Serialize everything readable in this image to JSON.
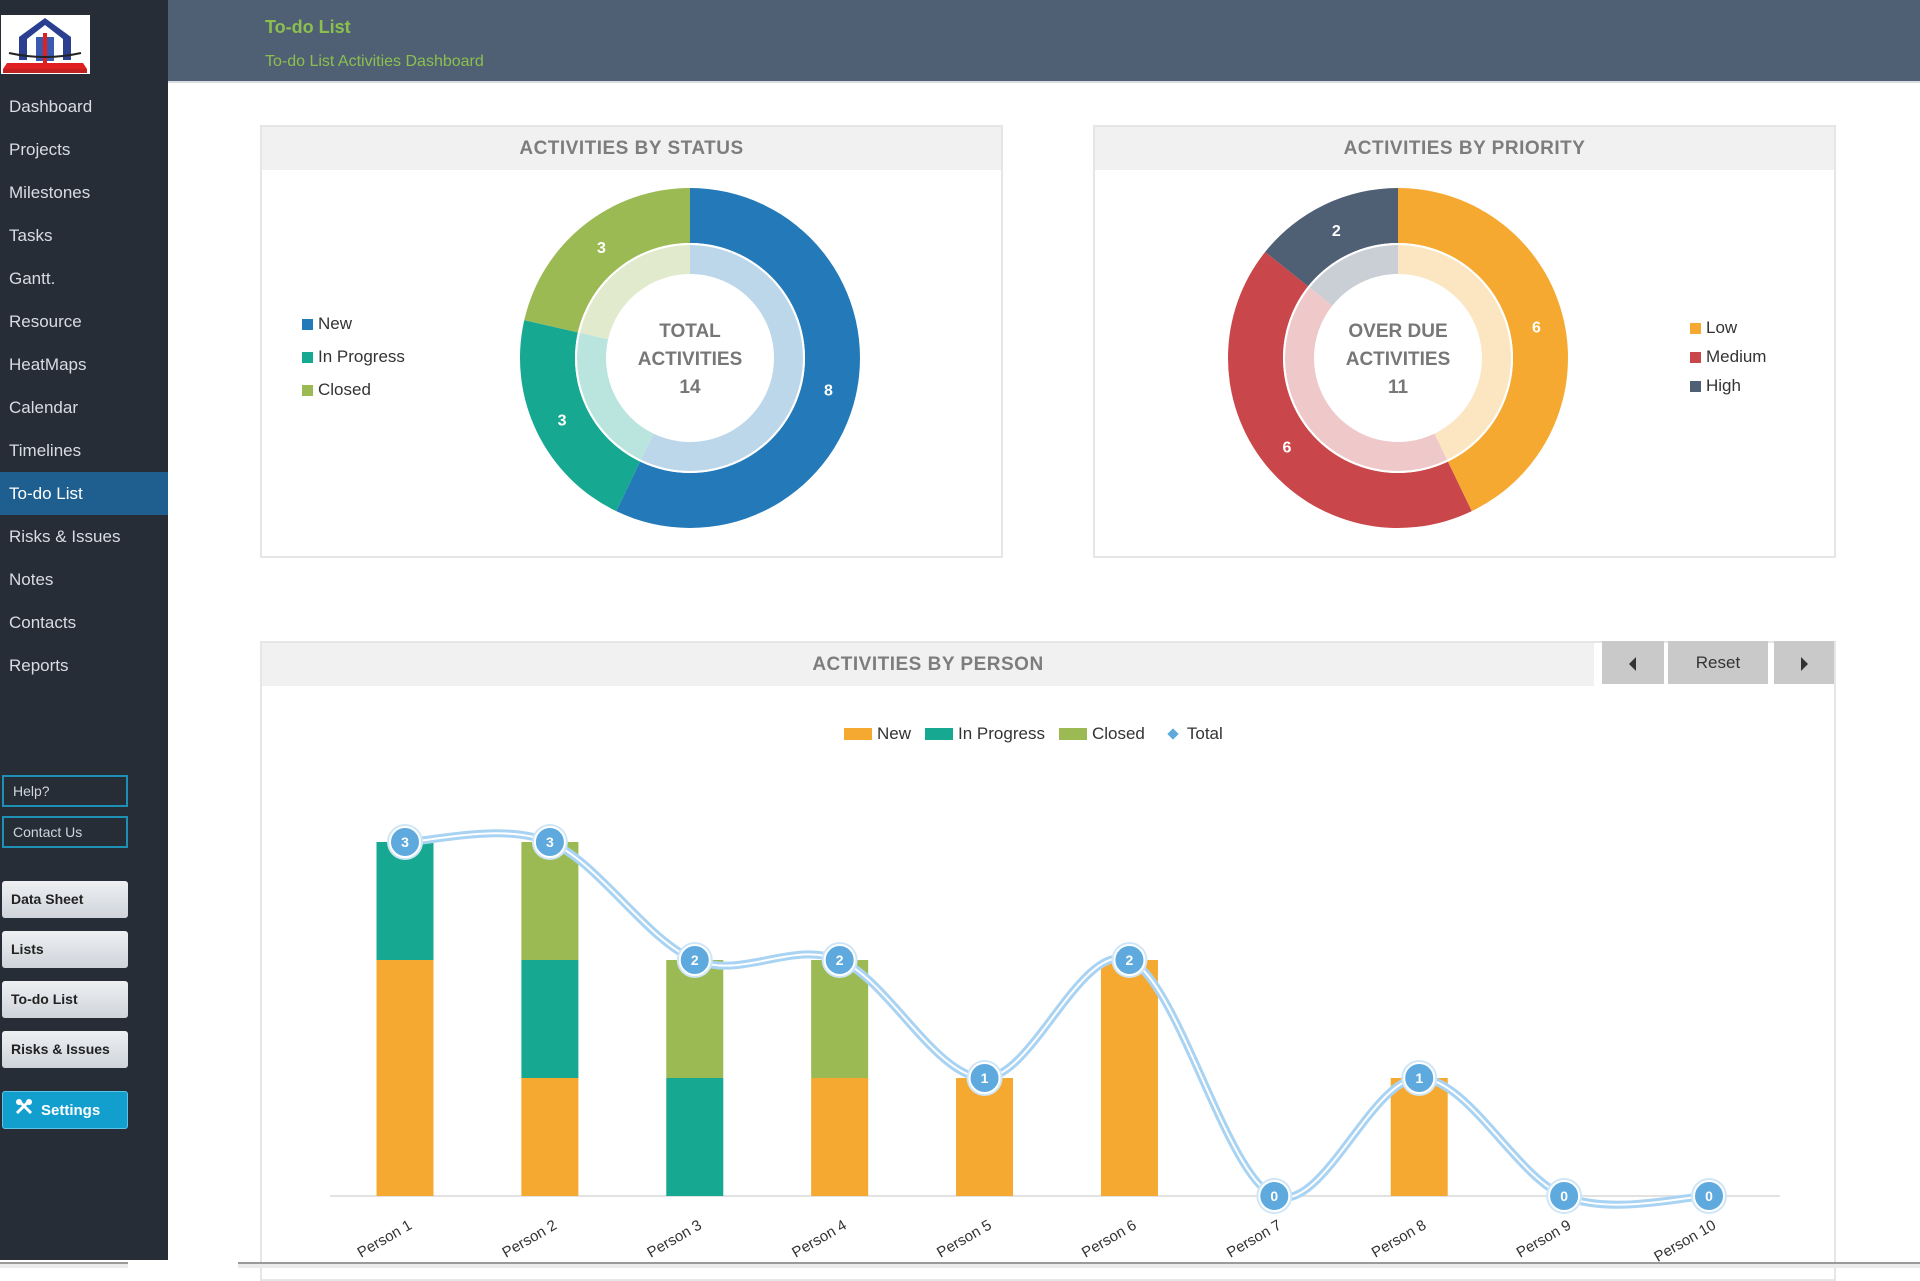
{
  "header": {
    "title": "To-do List",
    "subtitle": "To-do List Activities Dashboard"
  },
  "sidebar": {
    "logo": "company-logo",
    "items": [
      {
        "label": "Dashboard",
        "active": false
      },
      {
        "label": "Projects",
        "active": false
      },
      {
        "label": "Milestones",
        "active": false
      },
      {
        "label": "Tasks",
        "active": false
      },
      {
        "label": "Gantt.",
        "active": false
      },
      {
        "label": "Resource",
        "active": false
      },
      {
        "label": "HeatMaps",
        "active": false
      },
      {
        "label": "Calendar",
        "active": false
      },
      {
        "label": "Timelines",
        "active": false
      },
      {
        "label": "To-do List",
        "active": true
      },
      {
        "label": "Risks & Issues",
        "active": false
      },
      {
        "label": "Notes",
        "active": false
      },
      {
        "label": "Contacts",
        "active": false
      },
      {
        "label": "Reports",
        "active": false
      }
    ],
    "help_label": "Help?",
    "contact_label": "Contact Us",
    "buttons": [
      "Data Sheet",
      "Lists",
      "To-do List",
      "Risks & Issues"
    ],
    "settings_label": "Settings",
    "settings_icon": "tools-icon"
  },
  "colors": {
    "new": "#2479b9",
    "in_progress": "#17a892",
    "closed": "#9bba54",
    "low": "#f5a930",
    "medium": "#c9474a",
    "high": "#4f5f74",
    "bar_new": "#f5a930",
    "bar_in_progress": "#17a892",
    "bar_closed": "#9bba54",
    "total_line": "#5ea9dd"
  },
  "chart_data": [
    {
      "type": "pie",
      "title": "ACTIVITIES BY STATUS",
      "center_label": [
        "TOTAL",
        "ACTIVITIES",
        "14"
      ],
      "categories": [
        "New",
        "In Progress",
        "Closed"
      ],
      "values": [
        8,
        3,
        3
      ],
      "legend": "left"
    },
    {
      "type": "pie",
      "title": "ACTIVITIES BY PRIORITY",
      "center_label": [
        "OVER DUE",
        "ACTIVITIES",
        "11"
      ],
      "categories": [
        "Low",
        "Medium",
        "High"
      ],
      "values": [
        6,
        6,
        2
      ],
      "legend": "right"
    },
    {
      "type": "bar",
      "stacked": true,
      "title": "ACTIVITIES BY PERSON",
      "categories": [
        "Person 1",
        "Person 2",
        "Person 3",
        "Person 4",
        "Person 5",
        "Person 6",
        "Person 7",
        "Person 8",
        "Person 9",
        "Person 10"
      ],
      "series": [
        {
          "name": "New",
          "values": [
            2,
            1,
            0,
            1,
            1,
            2,
            0,
            1,
            0,
            0
          ]
        },
        {
          "name": "In Progress",
          "values": [
            1,
            1,
            1,
            0,
            0,
            0,
            0,
            0,
            0,
            0
          ]
        },
        {
          "name": "Closed",
          "values": [
            0,
            1,
            1,
            1,
            0,
            0,
            0,
            0,
            0,
            0
          ]
        },
        {
          "name": "Total",
          "type": "line",
          "values": [
            3,
            3,
            2,
            2,
            1,
            2,
            0,
            1,
            0,
            0
          ]
        }
      ],
      "legend": "top",
      "ylim": [
        0,
        3
      ],
      "grid": false,
      "controls": {
        "prev": "prev-icon",
        "reset": "Reset",
        "next": "next-icon"
      }
    }
  ]
}
